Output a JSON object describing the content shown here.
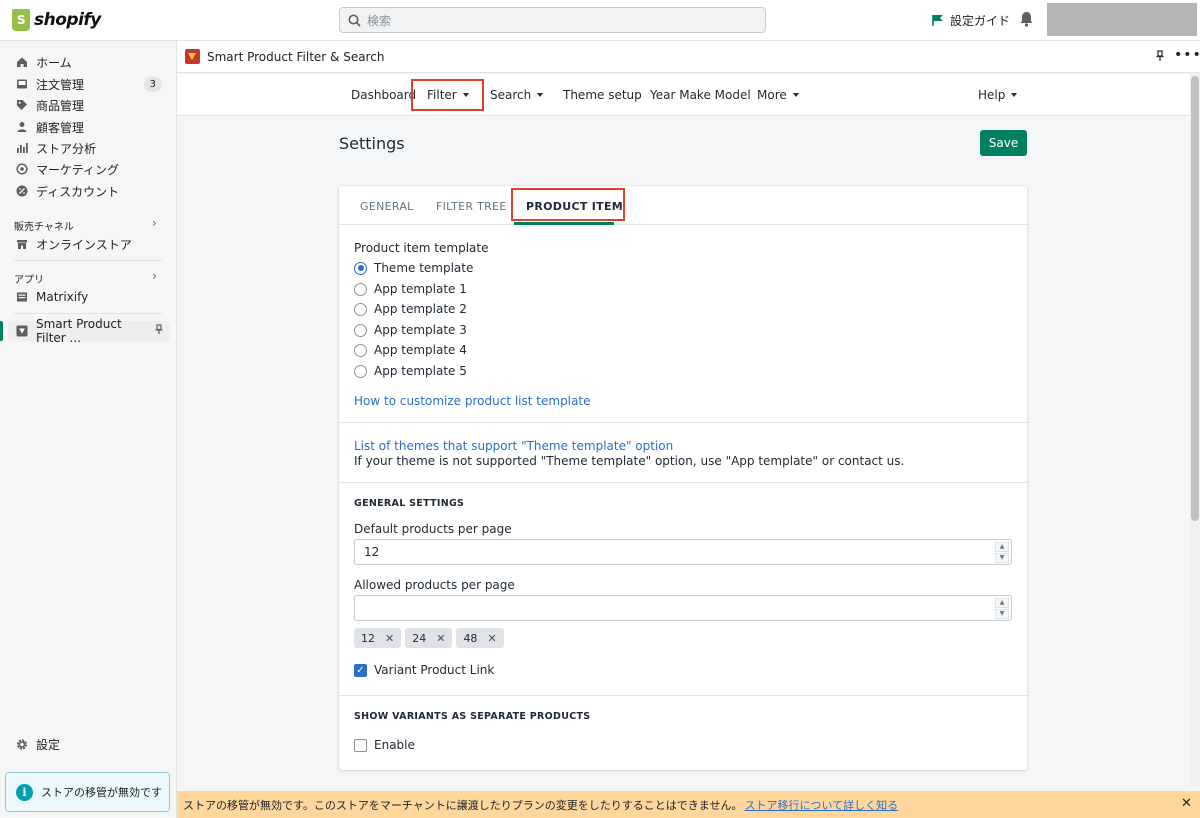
{
  "topbar": {
    "logo_text": "shopify",
    "search_placeholder": "検索",
    "setup_guide": "設定ガイド"
  },
  "sidebar": {
    "items": [
      {
        "label": "ホーム",
        "icon": "home-icon"
      },
      {
        "label": "注文管理",
        "icon": "orders-icon",
        "badge": "3"
      },
      {
        "label": "商品管理",
        "icon": "tag-icon"
      },
      {
        "label": "顧客管理",
        "icon": "person-icon"
      },
      {
        "label": "ストア分析",
        "icon": "bar-chart-icon"
      },
      {
        "label": "マーケティング",
        "icon": "target-icon"
      },
      {
        "label": "ディスカウント",
        "icon": "discount-icon"
      }
    ],
    "sales_channels_label": "販売チャネル",
    "online_store": "オンラインストア",
    "apps_label": "アプリ",
    "matrixify": "Matrixify",
    "smart_app": "Smart Product Filter ...",
    "settings": "設定",
    "store_notice": "ストアの移管が無効です"
  },
  "app_header": {
    "title": "Smart Product Filter & Search"
  },
  "app_nav": {
    "tabs": [
      "Dashboard",
      "Filter",
      "Search",
      "Theme setup",
      "Year Make Model",
      "More"
    ],
    "help": "Help"
  },
  "page": {
    "title": "Settings",
    "save": "Save"
  },
  "card": {
    "tabs": [
      "GENERAL",
      "FILTER TREE",
      "PRODUCT ITEM"
    ],
    "active_tab": "PRODUCT ITEM",
    "template_label": "Product item template",
    "templates": [
      "Theme template",
      "App template 1",
      "App template 2",
      "App template 3",
      "App template 4",
      "App template 5"
    ],
    "selected_template": "Theme template",
    "customize_link": "How to customize product list template",
    "themes_link": "List of themes that support \"Theme template\" option",
    "themes_note": "If your theme is not supported \"Theme template\" option, use \"App template\" or contact us.",
    "general_settings": "GENERAL SETTINGS",
    "default_per_page_label": "Default products per page",
    "default_per_page_value": "12",
    "allowed_per_page_label": "Allowed products per page",
    "allowed_per_page_value": "",
    "allowed_tags": [
      "12",
      "24",
      "48"
    ],
    "variant_link_label": "Variant Product Link",
    "variant_link_checked": true,
    "show_variants_heading": "SHOW VARIANTS AS SEPARATE PRODUCTS",
    "enable_label": "Enable",
    "enable_checked": false
  },
  "banner": {
    "text": "ストアの移管が無効です。このストアをマーチャントに譲渡したりプランの変更をしたりすることはできません。",
    "link": "ストア移行について詳しく知る"
  },
  "colors": {
    "primary": "#008060",
    "link": "#2c6ecb",
    "highlight": "#d9452b",
    "banner": "#ffd79d"
  }
}
